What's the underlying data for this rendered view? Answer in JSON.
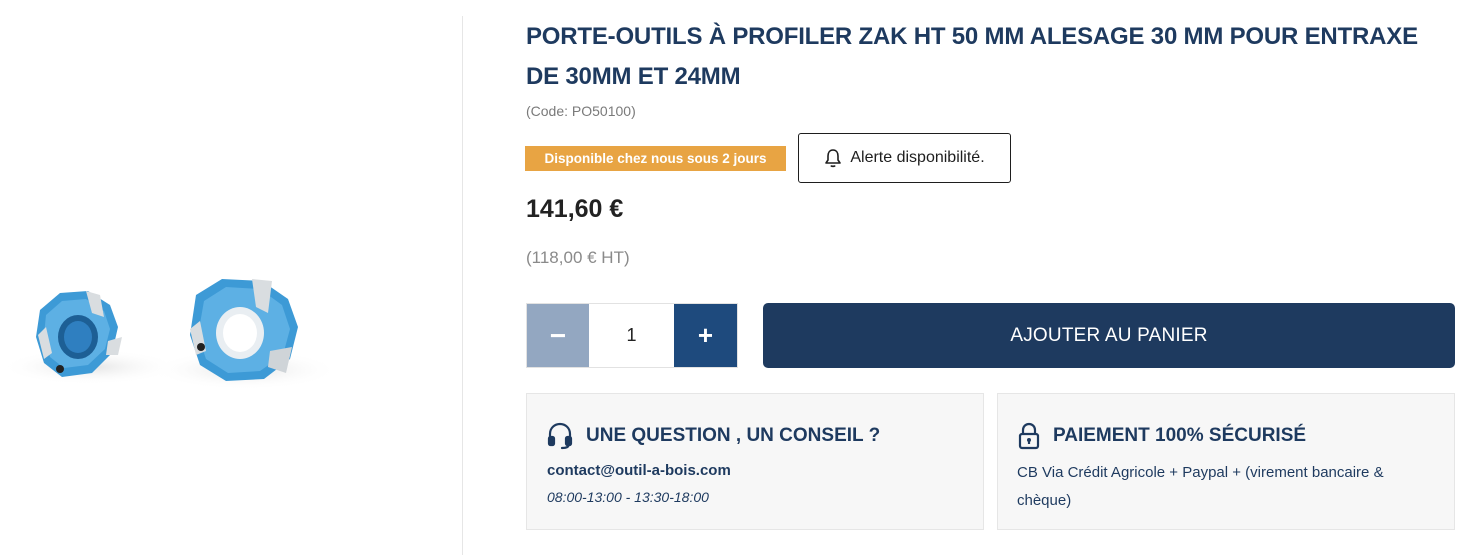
{
  "product": {
    "title": "PORTE-OUTILS À PROFILER ZAK HT 50 MM ALESAGE 30 MM POUR ENTRAXE DE 30MM ET 24MM",
    "code": "(Code: PO50100)",
    "availability": "Disponible chez nous sous 2 jours",
    "alert_label": "Alerte disponibilité.",
    "price": "141,60 €",
    "price_ht": "(118,00 € HT)",
    "image_icon": "product-photo-cutter-heads"
  },
  "quantity": {
    "minus_label": "−",
    "value": "1",
    "plus_label": "+"
  },
  "cart": {
    "add_label": "AJOUTER AU PANIER"
  },
  "support": {
    "icon": "headset-icon",
    "title": "UNE QUESTION , UN CONSEIL ?",
    "email": "contact@outil-a-bois.com",
    "hours": "08:00-13:00 - 13:30-18:00"
  },
  "payment": {
    "icon": "lock-icon",
    "title": "PAIEMENT 100% SÉCURISÉ",
    "text": "CB Via Crédit Agricole + Paypal + (virement bancaire & chèque)"
  },
  "colors": {
    "primary": "#1e3a5f",
    "badge": "#e8a443",
    "qty_minus": "#93a7c1",
    "qty_plus": "#1e4a7d",
    "product_blue": "#3d9ad6"
  }
}
